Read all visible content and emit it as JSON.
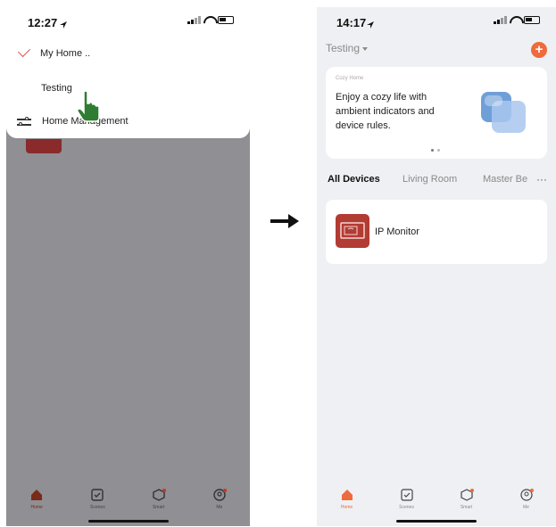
{
  "left_screen": {
    "status_time": "12:27",
    "menu": {
      "items": [
        {
          "label": "My Home ..",
          "checked": true
        },
        {
          "label": "Testing",
          "checked": false
        },
        {
          "label": "Home Management",
          "icon": "sliders-icon"
        }
      ]
    },
    "tab_bar": {
      "items": [
        {
          "label": "Home",
          "icon": "home-icon",
          "active": true
        },
        {
          "label": "Scenes",
          "icon": "check-square-icon"
        },
        {
          "label": "Smart",
          "icon": "smart-icon"
        },
        {
          "label": "Me",
          "icon": "profile-icon"
        }
      ]
    }
  },
  "right_screen": {
    "status_time": "14:17",
    "home_name": "Testing",
    "banner": {
      "tag": "Cozy Home",
      "text": "Enjoy a cozy life with ambient indicators and device rules."
    },
    "room_tabs": [
      "All Devices",
      "Living Room",
      "Master Be"
    ],
    "devices": [
      {
        "name": "IP Monitor",
        "icon": "monitor-icon"
      }
    ],
    "tab_bar": {
      "items": [
        {
          "label": "Home",
          "icon": "home-icon",
          "active": true
        },
        {
          "label": "Scenes",
          "icon": "check-square-icon"
        },
        {
          "label": "Smart",
          "icon": "smart-icon"
        },
        {
          "label": "Me",
          "icon": "profile-icon"
        }
      ]
    }
  },
  "colors": {
    "accent": "#ef6a3c",
    "dim_overlay": "#8f8f94",
    "device_red": "#b23b33",
    "cursor_green": "#2e7d32"
  }
}
